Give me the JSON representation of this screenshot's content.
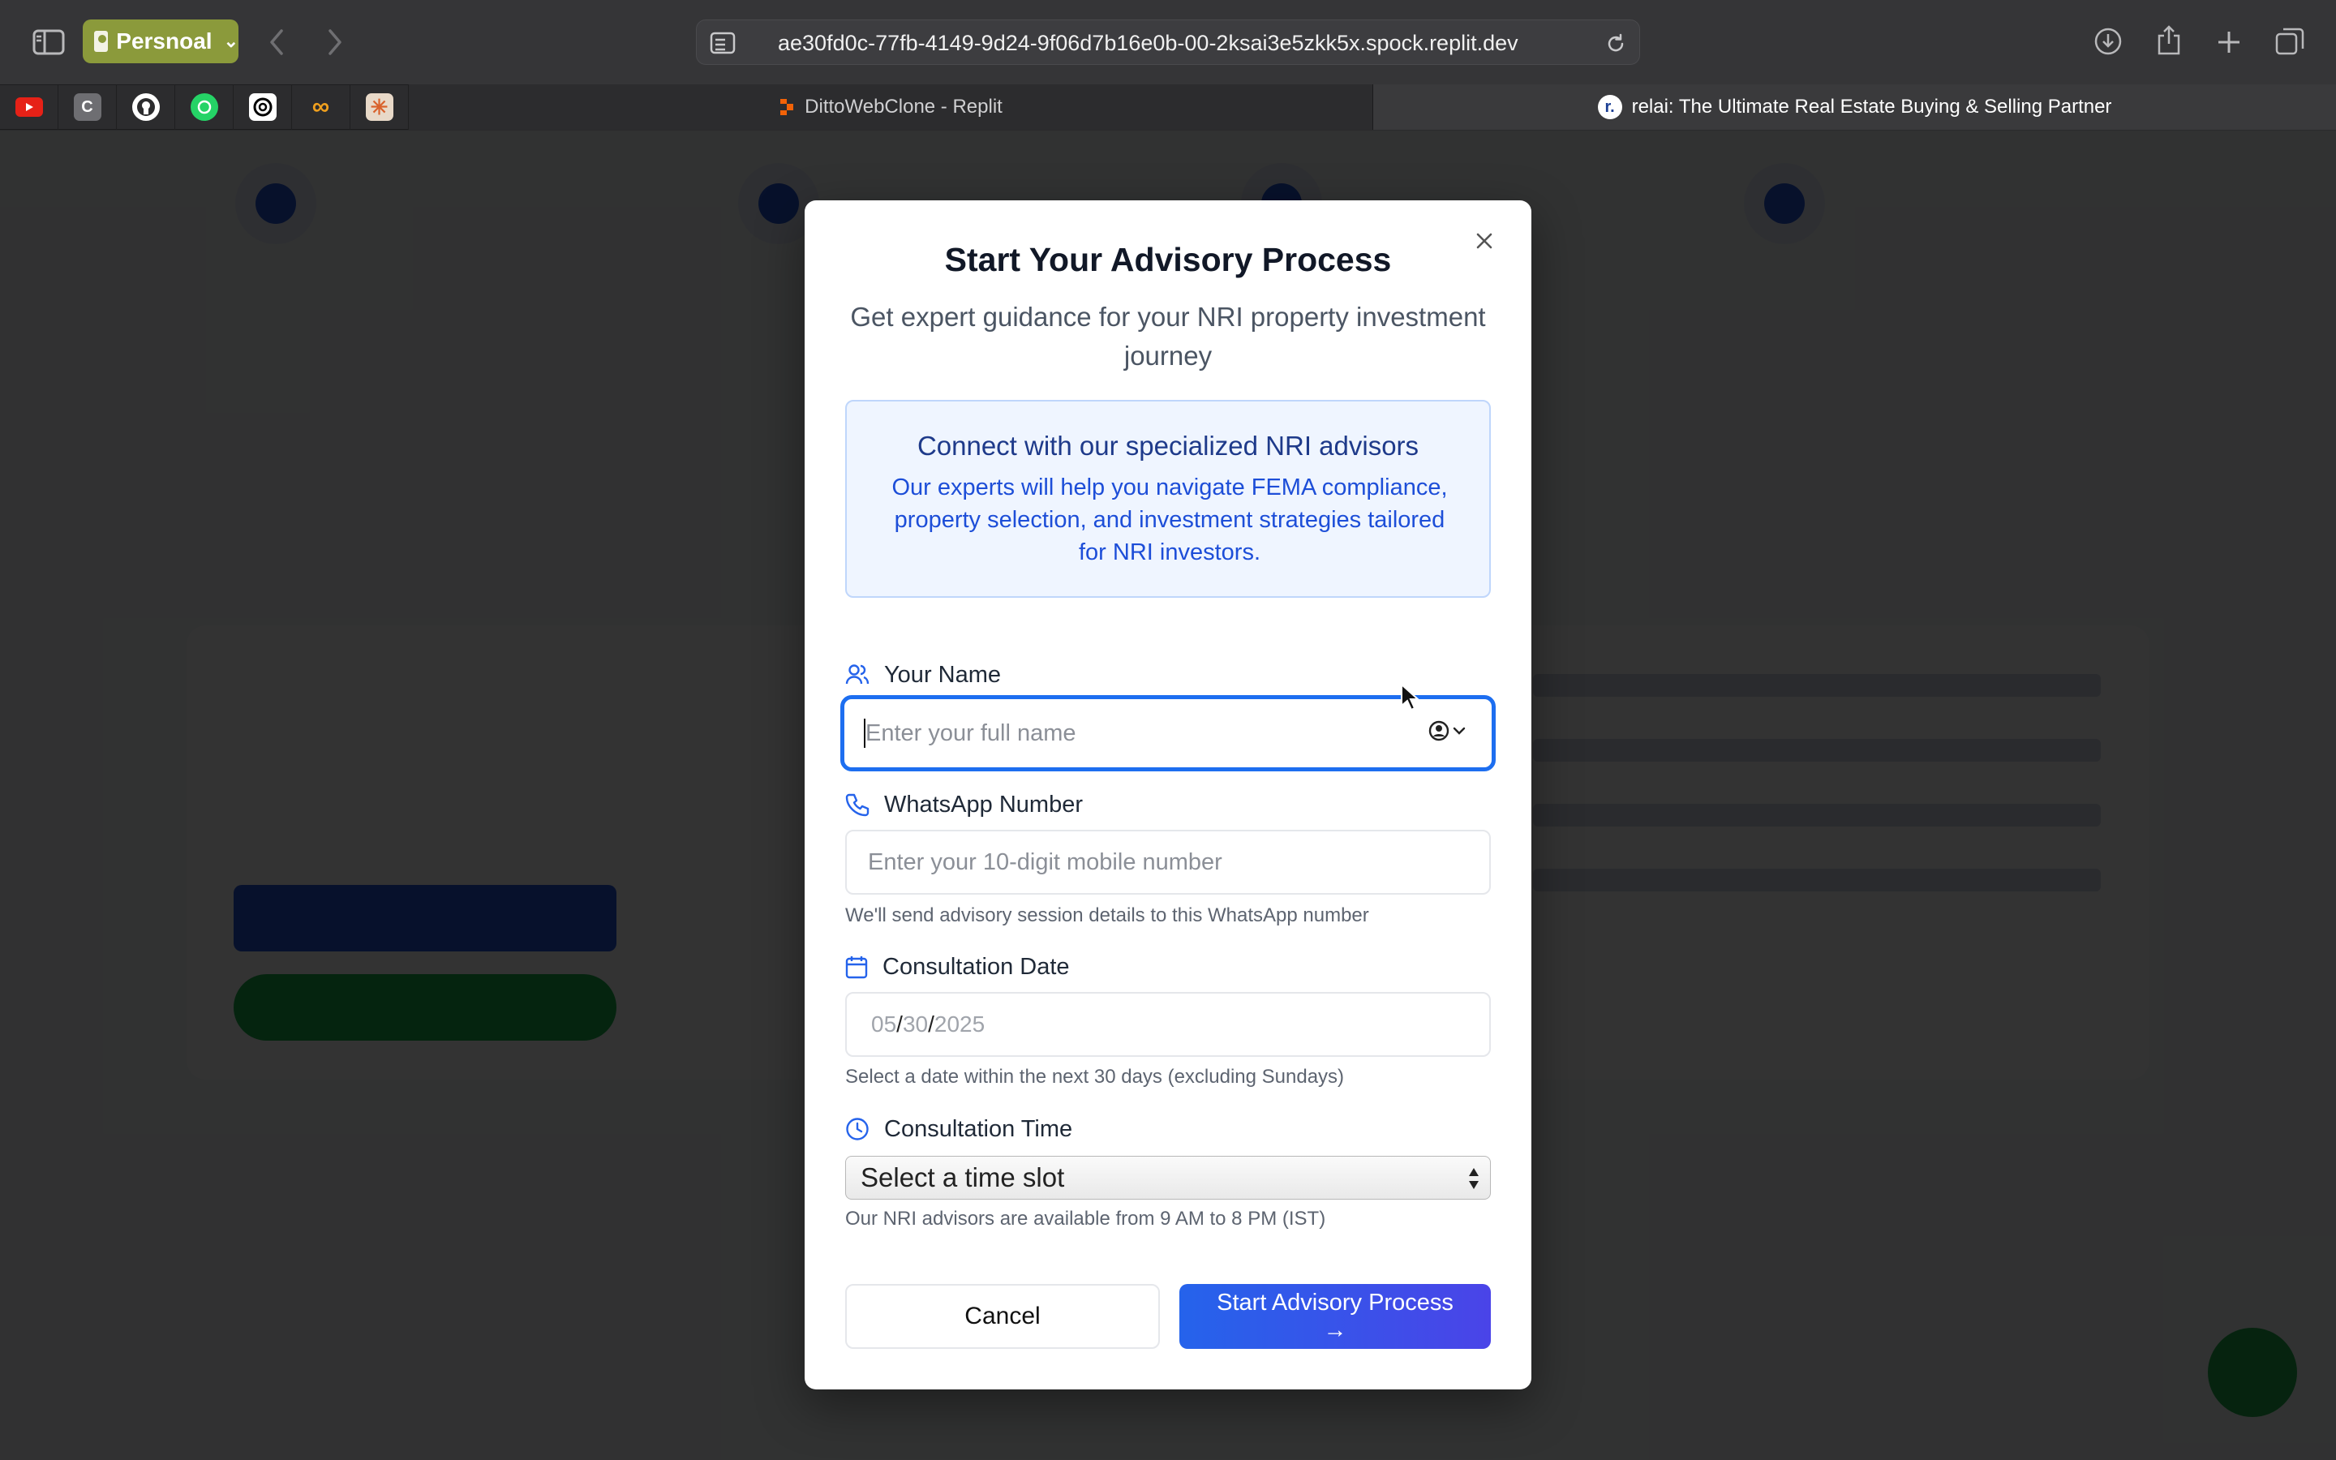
{
  "browser": {
    "profile_label": "Persnoal",
    "url": "ae30fd0c-77fb-4149-9d24-9f06d7b16e0b-00-2ksai3e5zkk5x.spock.replit.dev",
    "bookmarks": [
      {
        "name": "youtube-icon",
        "color": "#e62117"
      },
      {
        "name": "c-icon",
        "color": "#6e6e72"
      },
      {
        "name": "github-icon",
        "color": "#2c2c2e"
      },
      {
        "name": "whatsapp-icon",
        "color": "#25d366"
      },
      {
        "name": "openai-icon",
        "color": "#000000"
      },
      {
        "name": "infinity-icon",
        "color": "#f0a01e"
      },
      {
        "name": "claude-icon",
        "color": "#e8d9c8"
      }
    ],
    "tabs": [
      {
        "label": "DittoWebClone - Replit",
        "active": false
      },
      {
        "label": "relai: The Ultimate Real Estate Buying & Selling Partner",
        "active": true
      }
    ]
  },
  "modal": {
    "title": "Start Your Advisory Process",
    "subtitle": "Get expert guidance for your NRI property investment journey",
    "info": {
      "heading": "Connect with our specialized NRI advisors",
      "body": "Our experts will help you navigate FEMA compliance, property selection, and investment strategies tailored for NRI investors."
    },
    "name_field": {
      "label": "Your Name",
      "placeholder": "Enter your full name",
      "value": ""
    },
    "whatsapp_field": {
      "label": "WhatsApp Number",
      "placeholder": "Enter your 10-digit mobile number",
      "hint": "We'll send advisory session details to this WhatsApp number"
    },
    "date_field": {
      "label": "Consultation Date",
      "month": "05",
      "day": "30",
      "year": "2025",
      "sep": "/",
      "hint": "Select a date within the next 30 days (excluding Sundays)"
    },
    "time_field": {
      "label": "Consultation Time",
      "selected": "Select a time slot",
      "hint": "Our NRI advisors are available from 9 AM to 8 PM (IST)"
    },
    "cancel_label": "Cancel",
    "submit_label": "Start Advisory Process",
    "submit_arrow": "→",
    "accent_color": "#2563eb"
  }
}
